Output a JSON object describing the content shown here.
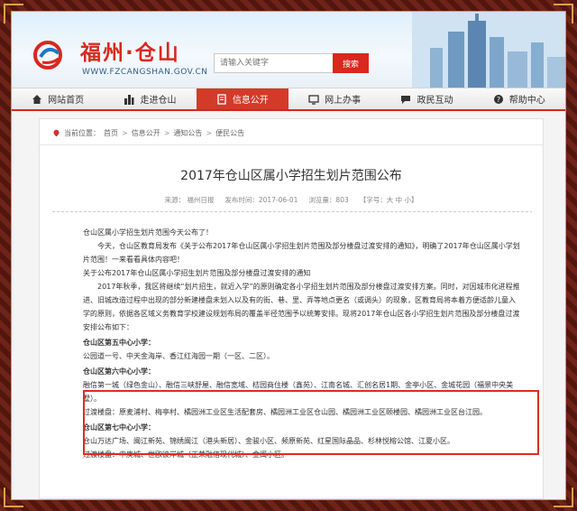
{
  "header": {
    "site_name": "福州·仓山",
    "site_url": "WWW.FZCANGSHAN.GOV.CN",
    "search_placeholder": "请输入关键字",
    "search_button": "搜索"
  },
  "nav": [
    {
      "label": "网站首页",
      "icon": "home-icon"
    },
    {
      "label": "走进仓山",
      "icon": "city-icon"
    },
    {
      "label": "信息公开",
      "icon": "document-icon",
      "active": true
    },
    {
      "label": "网上办事",
      "icon": "monitor-icon"
    },
    {
      "label": "政民互动",
      "icon": "chat-icon"
    },
    {
      "label": "帮助中心",
      "icon": "help-icon"
    }
  ],
  "breadcrumb": {
    "prefix": "当前位置：",
    "items": [
      "首页",
      "信息公开",
      "通知公告",
      "便民公告"
    ]
  },
  "article": {
    "title": "2017年仓山区属小学招生划片范围公布",
    "meta": {
      "source": "来源：  福州日报",
      "date": "发布时间：2017-06-01",
      "views": "浏览量：803",
      "font": "【字号：大 中 小】"
    },
    "paragraphs": {
      "p1": "仓山区属小学招生划片范围今天公布了！",
      "p2": "今天，仓山区教育局发布《关于公布2017年仓山区属小学招生划片范围及部分楼盘过渡安排的通知》，明确了2017年仓山区属小学划片范围！一来看看具体内容吧！",
      "p3": "关于公布2017年仓山区属小学招生划片范围及部分楼盘过渡安排的通知",
      "p4": "2017年秋季，我区将继续“划片招生，就近入学”的原则确定各小学招生划片范围及部分楼盘过渡安排方案。同时，对因城市化进程推进、旧城改造过程中出现的部分新建楼盘未划入以及有的街、巷、里、弄等地点更名（或调头）的现象，区教育局将本着方便适龄儿童入学的原则，依据各区域义务教育学校建设规划布局的覆盖半径范围予以统筹安排。现将2017年仓山区各小学招生划片范围及部分楼盘过渡安排公布如下：",
      "h5": "仓山区第五中心小学：",
      "p5": "公园道一号、中天金海岸、香江红海园一期（一区、二区）。",
      "h6": "仓山区第六中心小学：",
      "p6": "融信第一城（绿色金山）、融信三峡舒屋、融信宽域、桔园商住楼（鑫苑）、江南名城、汇创名居1期、金亭小区、金城花园（福景中央美墅）。",
      "p6b": "过渡楼盘：原麦浦村、梅亭村、橘园洲工业区生活配套房、橘园洲工业区仓山园、橘园洲工业区颐楼园、橘园洲工业区台江园。",
      "h7": "仓山区第七中心小学：",
      "p7": "仓山万达广场、闽江新苑、锦绣闽江（港头新居）、金骏小区、频原新苑、红星国际晶品、杉林悦榕公馆、江夏小区。",
      "p7b": "过渡楼盘：中庚城、世欧彼岸城（正荣融信现代城）、金闽小区。"
    }
  }
}
